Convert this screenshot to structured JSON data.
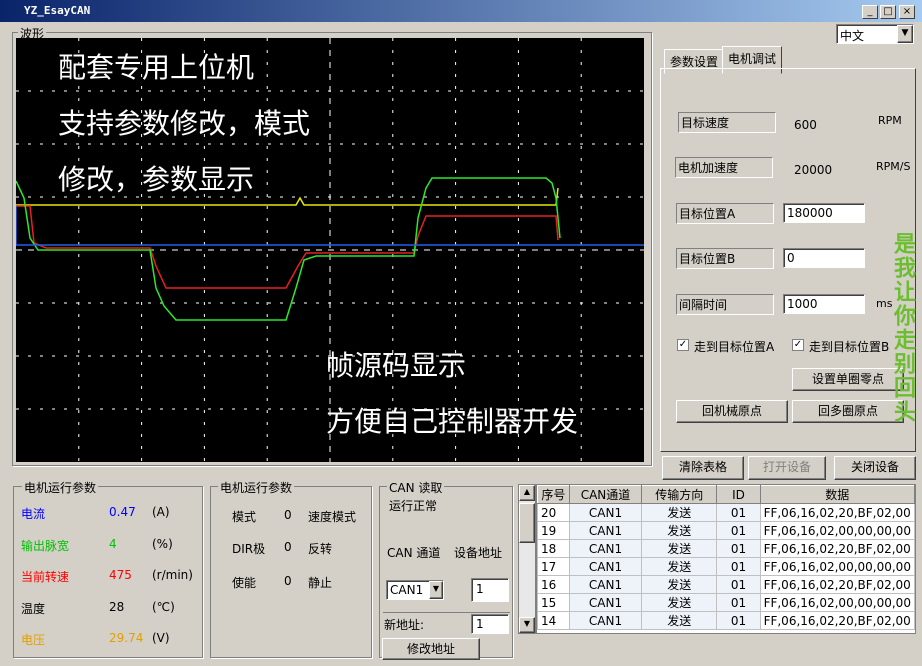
{
  "window": {
    "title": "YZ_EsayCAN",
    "min_label": "_",
    "max_label": "□",
    "close_label": "×"
  },
  "language": {
    "selected": "中文"
  },
  "waveform": {
    "group_label": "波形",
    "captions": [
      "配套专用上位机",
      "支持参数修改，模式",
      "修改，参数显示",
      "帧源码显示",
      "方便自己控制器开发"
    ],
    "colors": {
      "yellow": "#e8e800",
      "green": "#2ee82e",
      "red": "#e82020",
      "blue": "#2060e8",
      "grid": "#ffffff"
    }
  },
  "tabs": [
    {
      "label": "参数设置"
    },
    {
      "label": "电机调试"
    }
  ],
  "motor_debug": {
    "target_speed": {
      "label": "目标速度",
      "value": "600",
      "unit": "RPM"
    },
    "accel": {
      "label": "电机加速度",
      "value": "20000",
      "unit": "RPM/S"
    },
    "pos_a": {
      "label": "目标位置A",
      "value": "180000"
    },
    "pos_b": {
      "label": "目标位置B",
      "value": "0"
    },
    "interval": {
      "label": "间隔时间",
      "value": "1000",
      "unit": "ms"
    },
    "goto_a": {
      "label": "走到目标位置A",
      "checked": "✓"
    },
    "goto_b": {
      "label": "走到目标位置B",
      "checked": "✓"
    },
    "set_zero": "设置单圈零点",
    "home_mech": "回机械原点",
    "home_multi": "回多圈原点"
  },
  "side_text": "是我让你走别回头",
  "actions": {
    "clear": "清除表格",
    "open": "打开设备",
    "close": "关闭设备"
  },
  "motor_params": {
    "group_label": "电机运行参数",
    "rows": [
      {
        "name": "电流",
        "value": "0.47",
        "unit": "(A)",
        "color": "#0000ff"
      },
      {
        "name": "输出脉宽",
        "value": "4",
        "unit": "(%)",
        "color": "#00c000"
      },
      {
        "name": "当前转速",
        "value": "475",
        "unit": "(r/min)",
        "color": "#ff0000"
      },
      {
        "name": "温度",
        "value": "28",
        "unit": "(℃)",
        "color": "#000000"
      },
      {
        "name": "电压",
        "value": "29.74",
        "unit": "(V)",
        "color": "#e0a000"
      }
    ]
  },
  "motor_status": {
    "group_label": "电机运行参数",
    "rows": [
      {
        "name": "模式",
        "value": "0",
        "state": "速度模式"
      },
      {
        "name": "DIR极",
        "value": "0",
        "state": "反转"
      },
      {
        "name": "使能",
        "value": "0",
        "state": "静止"
      }
    ]
  },
  "can_read": {
    "group_label": "CAN 读取",
    "status": "运行正常",
    "channel_label": "CAN 通道",
    "address_label": "设备地址",
    "channel_value": "CAN1",
    "address_value": "1",
    "new_address_label": "新地址:",
    "new_address_value": "1",
    "modify_button": "修改地址"
  },
  "frames_table": {
    "headers": [
      "序号",
      "CAN通道",
      "传输方向",
      "ID",
      "数据"
    ],
    "rows": [
      [
        "20",
        "CAN1",
        "发送",
        "01",
        "FF,06,16,02,20,BF,02,00"
      ],
      [
        "19",
        "CAN1",
        "发送",
        "01",
        "FF,06,16,02,00,00,00,00"
      ],
      [
        "18",
        "CAN1",
        "发送",
        "01",
        "FF,06,16,02,20,BF,02,00"
      ],
      [
        "17",
        "CAN1",
        "发送",
        "01",
        "FF,06,16,02,00,00,00,00"
      ],
      [
        "16",
        "CAN1",
        "发送",
        "01",
        "FF,06,16,02,20,BF,02,00"
      ],
      [
        "15",
        "CAN1",
        "发送",
        "01",
        "FF,06,16,02,00,00,00,00"
      ],
      [
        "14",
        "CAN1",
        "发送",
        "01",
        "FF,06,16,02,20,BF,02,00"
      ]
    ]
  }
}
